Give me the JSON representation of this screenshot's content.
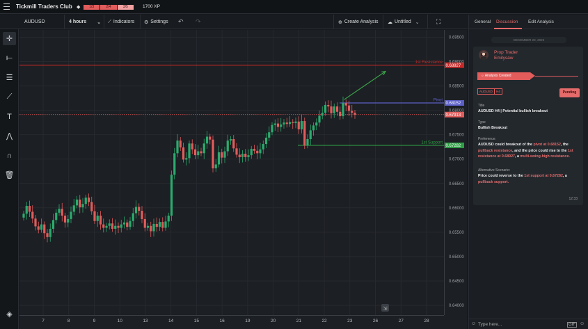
{
  "app": {
    "title": "Tickmill Traders Club",
    "xp_segments": [
      "1/3",
      "2/4",
      "3/5"
    ],
    "xp_label": "1700 XP"
  },
  "toolbar": {
    "symbol": "AUDUSD",
    "interval": "4 hours",
    "indicators": "Indicators",
    "settings": "Settings",
    "create_analysis": "Create Analysis",
    "layout_name": "Untitled"
  },
  "left_tools": [
    "crosshair-icon",
    "horizontal-line-icon",
    "fib-lines-icon",
    "trend-line-icon",
    "text-icon",
    "pattern-icon",
    "magnet-icon",
    "trash-icon",
    "layers-icon"
  ],
  "chart_data": {
    "type": "candlestick",
    "symbol": "AUDUSD",
    "interval": "4 hours",
    "y_ticks": [
      "0.69500",
      "0.69000",
      "0.68500",
      "0.68000",
      "0.67500",
      "0.67000",
      "0.66500",
      "0.66000",
      "0.65500",
      "0.65000",
      "0.64500",
      "0.64000"
    ],
    "ylim": [
      0.638,
      0.6965
    ],
    "x_ticks": [
      "7",
      "8",
      "9",
      "10",
      "13",
      "14",
      "15",
      "16",
      "19",
      "20",
      "21",
      "22",
      "23",
      "26",
      "27",
      "28"
    ],
    "levels": [
      {
        "name": "1st Resistance",
        "value": 0.68927,
        "label": "0.68927",
        "color": "#c62828"
      },
      {
        "name": "Pivot",
        "value": 0.68152,
        "label": "0.68152",
        "color": "#5b5fc7"
      },
      {
        "name": "1st Support",
        "value": 0.67282,
        "label": "0.67282",
        "color": "#2e9e45"
      }
    ],
    "current_price": {
      "value": 0.67913,
      "label": "0.67913",
      "color": "#e25c5c"
    },
    "closes": [
      0.6588,
      0.6604,
      0.6592,
      0.6578,
      0.6562,
      0.6555,
      0.6566,
      0.6548,
      0.654,
      0.6557,
      0.6575,
      0.659,
      0.6598,
      0.6584,
      0.657,
      0.6577,
      0.6592,
      0.6605,
      0.6617,
      0.6601,
      0.6608,
      0.6621,
      0.6612,
      0.6593,
      0.6573,
      0.6584,
      0.6566,
      0.6559,
      0.6563,
      0.6568,
      0.6557,
      0.6563,
      0.6559,
      0.6566,
      0.657,
      0.6561,
      0.6573,
      0.6589,
      0.6602,
      0.6594,
      0.6577,
      0.6559,
      0.6563,
      0.6552,
      0.6567,
      0.6561,
      0.6571,
      0.6559,
      0.6572,
      0.6584,
      0.6668,
      0.6712,
      0.6738,
      0.6724,
      0.6699,
      0.6702,
      0.6732,
      0.672,
      0.6708,
      0.6716,
      0.6712,
      0.6732,
      0.6746,
      0.674,
      0.6681,
      0.6689,
      0.6714,
      0.6703,
      0.6716,
      0.6738,
      0.6741,
      0.6722,
      0.6709,
      0.6704,
      0.6711,
      0.6704,
      0.6708,
      0.6721,
      0.6717,
      0.6712,
      0.672,
      0.6731,
      0.6744,
      0.6755,
      0.677,
      0.6773,
      0.6766,
      0.6771,
      0.6775,
      0.6772,
      0.6776,
      0.6774,
      0.6777,
      0.6761,
      0.6778,
      0.6728,
      0.6741,
      0.6759,
      0.6769,
      0.6775,
      0.6789,
      0.6795,
      0.6811,
      0.6808,
      0.6794,
      0.6808,
      0.6797,
      0.6788,
      0.6815,
      0.681,
      0.6799,
      0.6795,
      0.6791
    ],
    "projection_arrow": {
      "from": [
        106,
        0.6822
      ],
      "to": [
        120,
        0.688
      ]
    }
  },
  "right_panel": {
    "tabs": [
      "General",
      "Discussion",
      "Edit Analysis"
    ],
    "active_tab": "Discussion",
    "date_chip": "DECEMBER 23, 2025",
    "author_role": "Prop Trader",
    "author_name": "Emilysaw",
    "event": "Analysis Created",
    "tags": [
      "AUDUSD",
      "H4"
    ],
    "status": "Pending",
    "title_label": "Title",
    "title_value": "AUDUSD H4 | Potential bullish breakout",
    "type_label": "Type",
    "type_value": "Bullish Breakout",
    "preference_label": "Preference:",
    "preference_parts": [
      {
        "text": "AUDUSD could breakout of the ",
        "hl": false
      },
      {
        "text": "pivot at 0.68152",
        "hl": true
      },
      {
        "text": ", the ",
        "hl": false
      },
      {
        "text": "pullback resistance",
        "hl": true
      },
      {
        "text": ", and the price could rise to the ",
        "hl": false
      },
      {
        "text": "1st resistance at 0.68927",
        "hl": true
      },
      {
        "text": ", a ",
        "hl": false
      },
      {
        "text": "multi-swing-high resistance.",
        "hl": true
      }
    ],
    "alt_label": "Alternative Scenario:",
    "alt_parts": [
      {
        "text": "Price could reverse to the ",
        "hl": false
      },
      {
        "text": "1st support at 0.67282",
        "hl": true
      },
      {
        "text": ", a ",
        "hl": false
      },
      {
        "text": "pullback support.",
        "hl": true
      }
    ],
    "time": "12:33",
    "composer_placeholder": "Type here..."
  }
}
